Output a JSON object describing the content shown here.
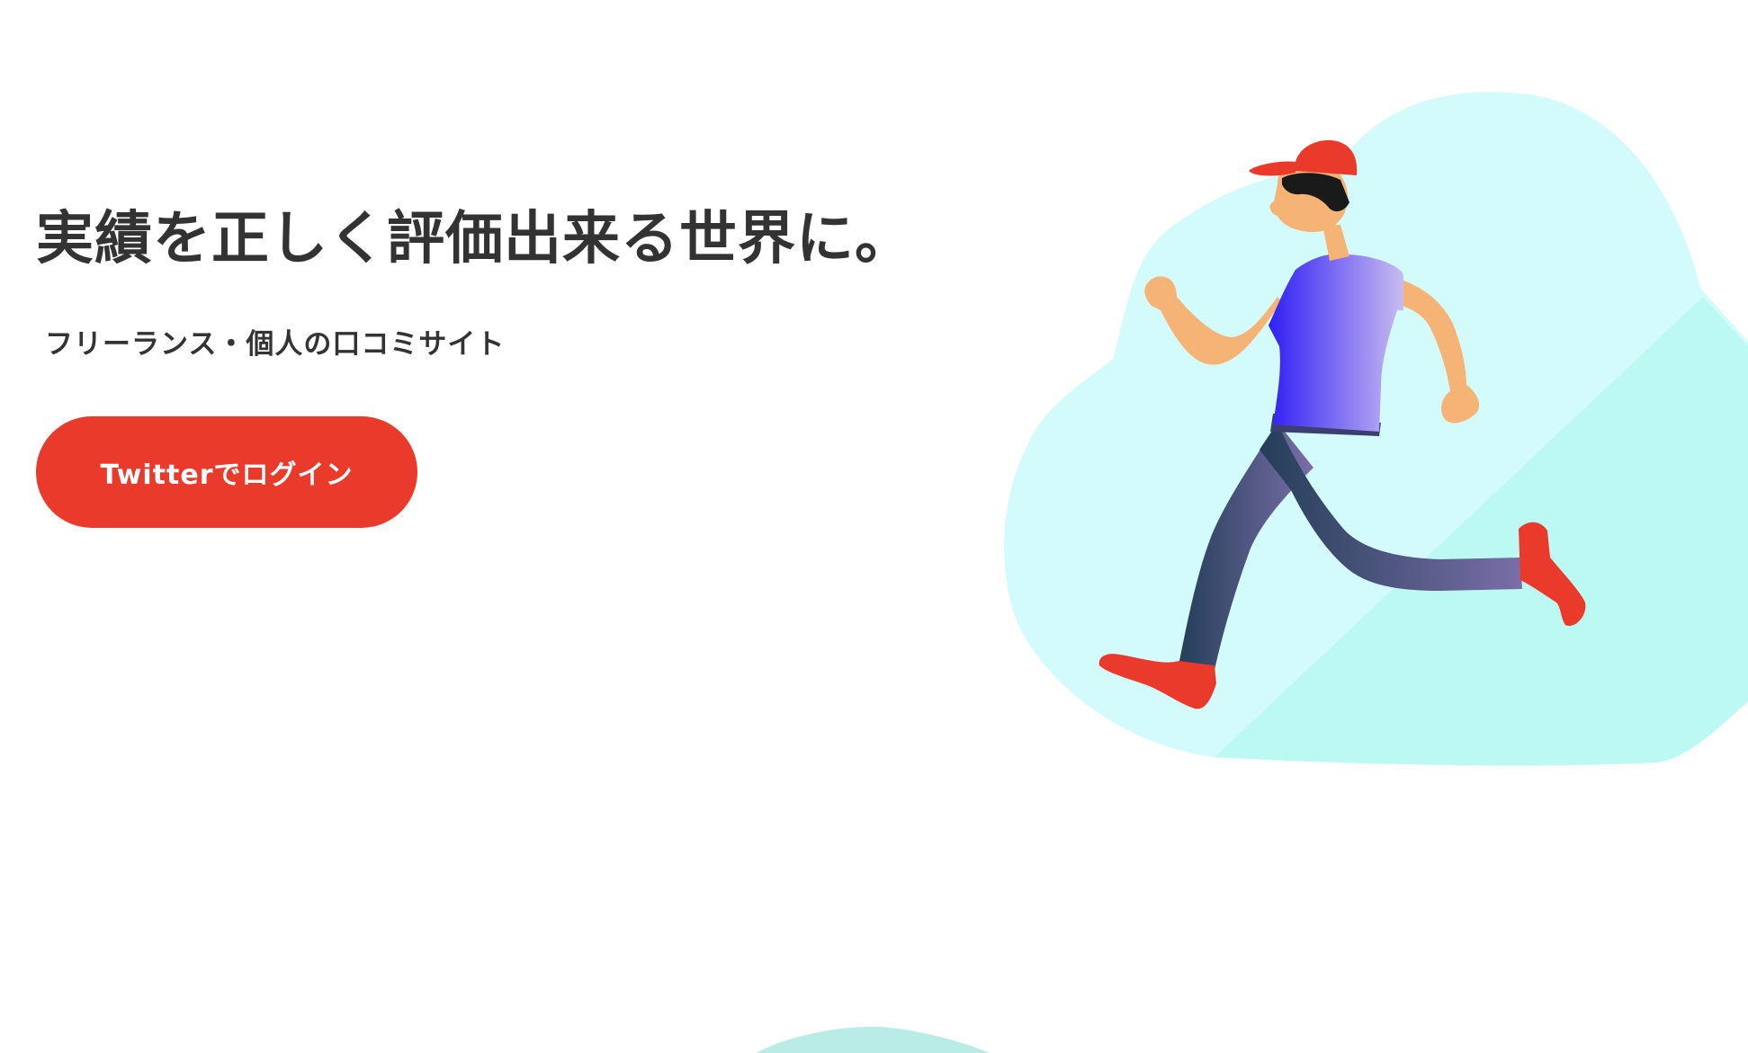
{
  "hero": {
    "headline": "実績を正しく評価出来る世界に。",
    "subline": "フリーランス・個人の口コミサイト",
    "login_button_label": "Twitterでログイン"
  },
  "colors": {
    "accent": "#ea3a2b",
    "text": "#333333",
    "blob_light": "#d4fbfb",
    "blob_mint": "#bdf9f3",
    "skin": "#f5b475",
    "shirt_start": "#2f1ff5",
    "shirt_end": "#c9bcf0",
    "pants_start": "#243e58",
    "pants_end": "#7a6ea8",
    "hair": "#1a1a1a"
  },
  "illustration": {
    "name": "running-person-illustration"
  }
}
